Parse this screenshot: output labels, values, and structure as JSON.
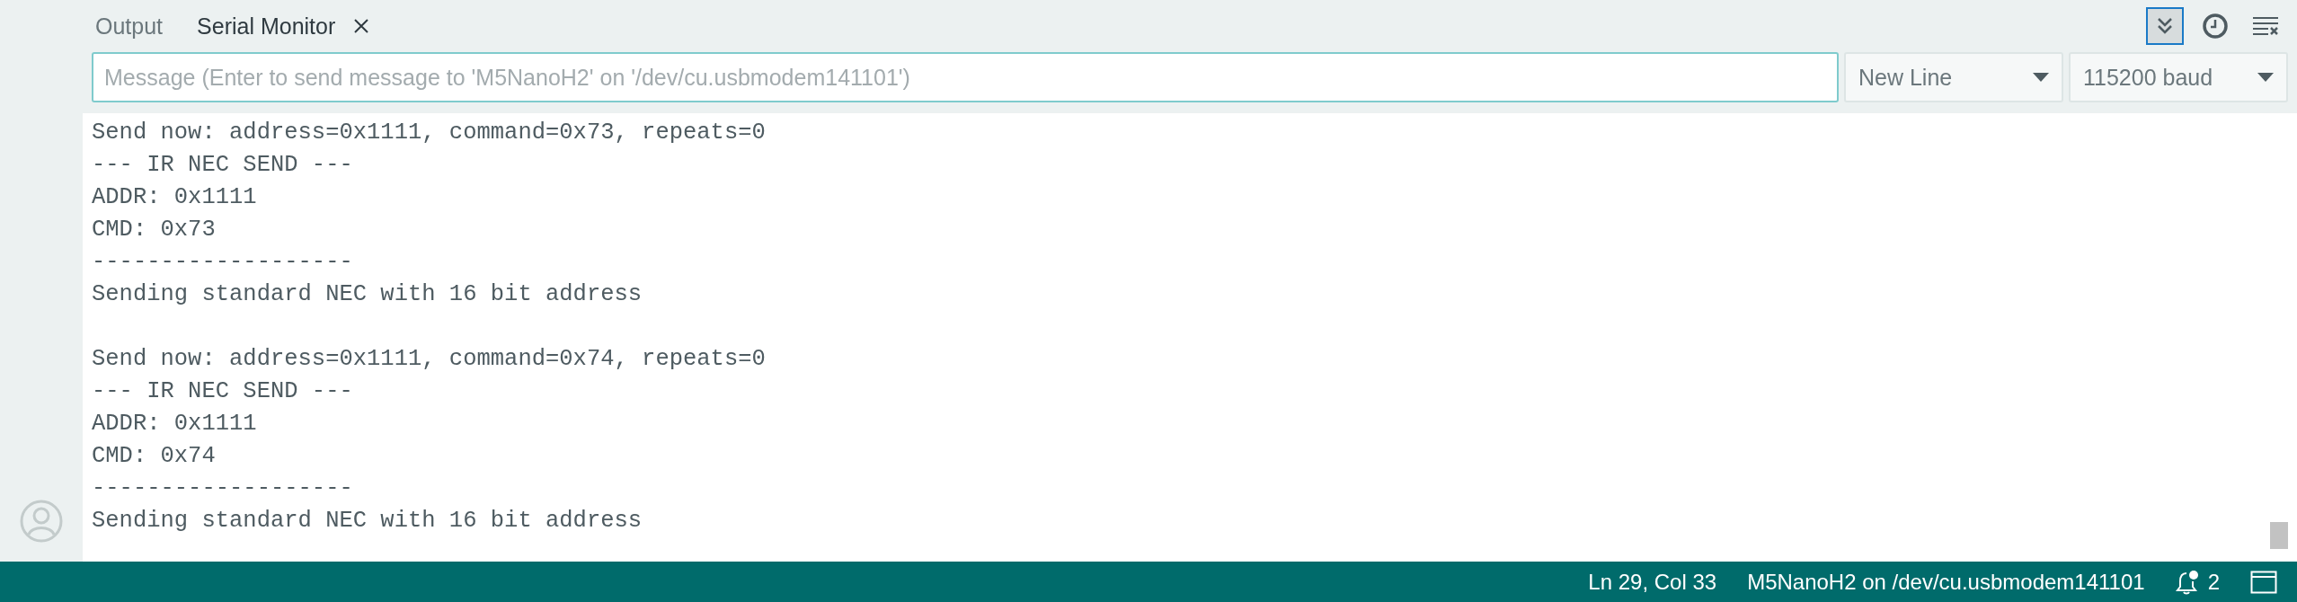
{
  "tabs": [
    {
      "label": "Output",
      "selected": false,
      "closable": false
    },
    {
      "label": "Serial Monitor",
      "selected": true,
      "closable": true
    }
  ],
  "toolbar": {
    "autoscroll": {
      "selected": true
    },
    "timestamp": {
      "selected": false
    }
  },
  "message": {
    "placeholder": "Message (Enter to send message to 'M5NanoH2' on '/dev/cu.usbmodem141101')"
  },
  "line_ending": {
    "value": "New Line"
  },
  "baud_rate": {
    "value": "115200 baud"
  },
  "output": [
    [
      "Send now: address=0x1111, command=0x73, repeats=0",
      "--- IR NEC SEND ---",
      "ADDR: 0x1111",
      "CMD: 0x73",
      "-------------------",
      "Sending standard NEC with 16 bit address"
    ],
    [
      "Send now: address=0x1111, command=0x74, repeats=0",
      "--- IR NEC SEND ---",
      "ADDR: 0x1111",
      "CMD: 0x74",
      "-------------------",
      "Sending standard NEC with 16 bit address"
    ]
  ],
  "status_bar": {
    "position": "Ln 29, Col 33",
    "board": "M5NanoH2 on /dev/cu.usbmodem141101",
    "notifications": "2"
  }
}
